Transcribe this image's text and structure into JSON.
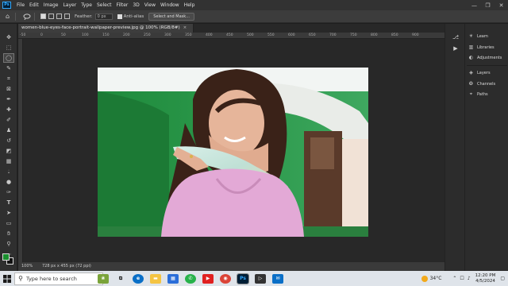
{
  "app": {
    "logo": "Ps"
  },
  "menu": [
    "File",
    "Edit",
    "Image",
    "Layer",
    "Type",
    "Select",
    "Filter",
    "3D",
    "View",
    "Window",
    "Help"
  ],
  "window_controls": {
    "minimize": "—",
    "maximize": "❐",
    "close": "✕"
  },
  "options": {
    "feather_label": "Feather:",
    "feather_value": "0 px",
    "antialias_label": "Anti-alias",
    "select_mask_label": "Select and Mask..."
  },
  "document": {
    "tab_title": "women-blue-eyes-face-portrait-wallpaper-preview.jpg @ 100% (RGB/8#)",
    "tab_close": "×",
    "ruler_ticks": [
      "-50",
      "0",
      "50",
      "100",
      "150",
      "200",
      "250",
      "300",
      "350",
      "400",
      "450",
      "500",
      "550",
      "600",
      "650",
      "700",
      "750",
      "800",
      "850",
      "900"
    ],
    "zoom": "100%",
    "dimensions": "728 px x 455 px (72 ppi)"
  },
  "panels": [
    {
      "label": "Learn",
      "icon": "bulb-icon"
    },
    {
      "label": "Libraries",
      "icon": "libraries-icon"
    },
    {
      "label": "Adjustments",
      "icon": "adjustments-icon"
    },
    {
      "label": "Layers",
      "icon": "layers-icon"
    },
    {
      "label": "Channels",
      "icon": "channels-icon"
    },
    {
      "label": "Paths",
      "icon": "paths-icon"
    }
  ],
  "colors": {
    "foreground": "#1a8f2e",
    "background": "#111111",
    "accent": "#31a8ff"
  },
  "taskbar": {
    "search_placeholder": "Type here to search",
    "weather": "34°C",
    "time": "12:20 PM",
    "date": "4/5/2024"
  }
}
